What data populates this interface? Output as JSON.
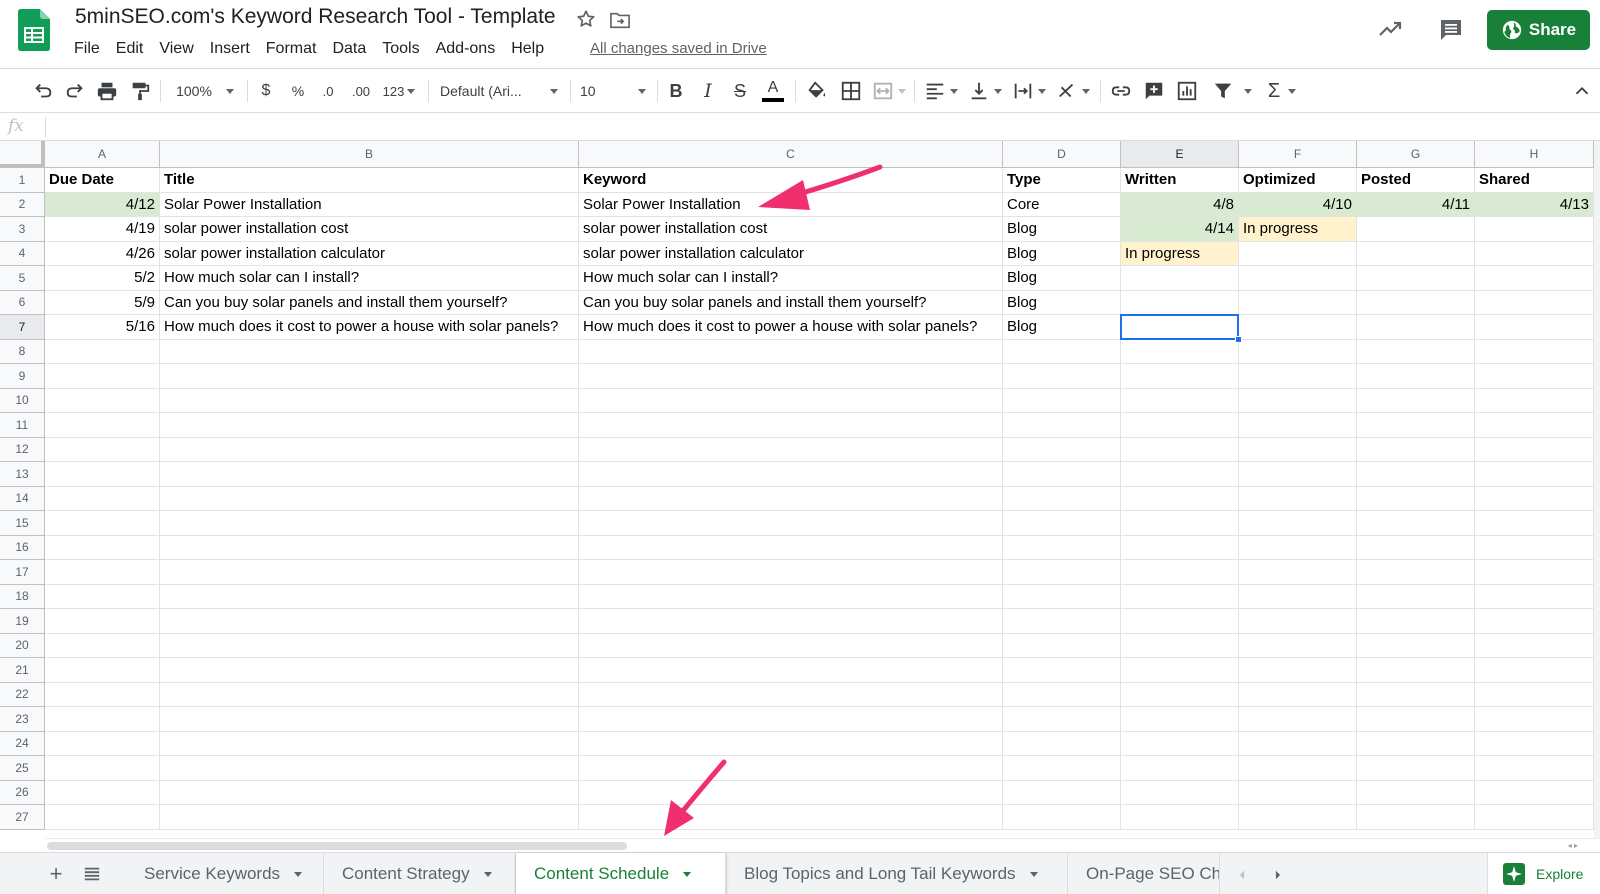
{
  "document": {
    "title": "5minSEO.com's Keyword Research Tool - Template",
    "save_status": "All changes saved in Drive"
  },
  "menu": [
    "File",
    "Edit",
    "View",
    "Insert",
    "Format",
    "Data",
    "Tools",
    "Add-ons",
    "Help"
  ],
  "share_label": "Share",
  "toolbar": {
    "zoom": "100%",
    "currency": "$",
    "percent": "%",
    "decrease_decimals": ".0",
    "increase_decimals": ".00",
    "more_formats": "123",
    "font": "Default (Ari...",
    "font_size": "10",
    "formula_label": "fx"
  },
  "sheet": {
    "columns": [
      "A",
      "B",
      "C",
      "D",
      "E",
      "F",
      "G",
      "H"
    ],
    "rows": [
      "1",
      "2",
      "3",
      "4",
      "5",
      "6",
      "7",
      "8",
      "9",
      "10",
      "11",
      "12",
      "13",
      "14",
      "15",
      "16",
      "17",
      "18",
      "19",
      "20",
      "21",
      "22",
      "23",
      "24",
      "25",
      "26",
      "27"
    ],
    "header": [
      "Due Date",
      "Title",
      "Keyword",
      "Type",
      "Written",
      "Optimized",
      "Posted",
      "Shared"
    ],
    "data": [
      [
        "4/12",
        "Solar Power Installation",
        "Solar Power Installation",
        "Core",
        "4/8",
        "4/10",
        "4/11",
        "4/13"
      ],
      [
        "4/19",
        "solar power installation cost",
        "solar power installation cost",
        "Blog",
        "4/14",
        "In progress",
        "",
        ""
      ],
      [
        "4/26",
        "solar power installation calculator",
        "solar power installation calculator",
        "Blog",
        "In progress",
        "",
        "",
        ""
      ],
      [
        "5/2",
        "How much solar can I install?",
        "How much solar can I install?",
        "Blog",
        "",
        "",
        "",
        ""
      ],
      [
        "5/9",
        "Can you buy solar panels and install them yourself?",
        "Can you buy solar panels and install them yourself?",
        "Blog",
        "",
        "",
        "",
        ""
      ],
      [
        "5/16",
        "How much does it cost to power a house with solar panels?",
        "How much does it cost to power a house with solar panels?",
        "Blog",
        "",
        "",
        "",
        ""
      ]
    ],
    "fill_colors": {
      "green": "#d9ead3",
      "yellow": "#fff2cc"
    },
    "active_cell": "E7"
  },
  "tabs": [
    "Service Keywords",
    "Content Strategy",
    "Content Schedule",
    "Blog Topics and Long Tail Keywords",
    "On-Page SEO Ch"
  ],
  "active_tab": "Content Schedule",
  "explore_label": "Explore",
  "colors": {
    "accent": "#188038",
    "annotation_arrow": "#f0306e",
    "selection": "#1a73e8"
  }
}
